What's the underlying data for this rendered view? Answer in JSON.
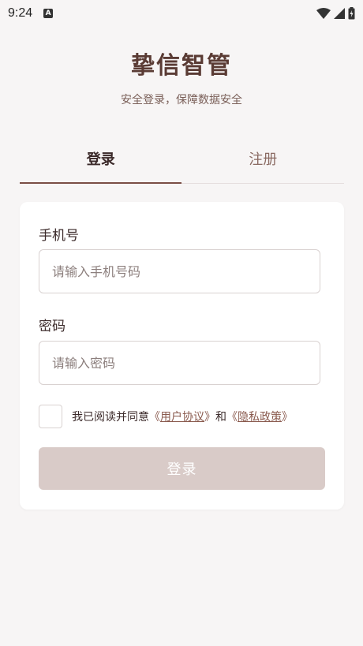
{
  "status_bar": {
    "time": "9:24",
    "notification_letter": "A"
  },
  "header": {
    "title": "挚信智管",
    "subtitle": "安全登录，保障数据安全"
  },
  "tabs": [
    {
      "label": "登录",
      "active": true
    },
    {
      "label": "注册",
      "active": false
    }
  ],
  "form": {
    "phone": {
      "label": "手机号",
      "placeholder": "请输入手机号码",
      "value": ""
    },
    "password": {
      "label": "密码",
      "placeholder": "请输入密码",
      "value": ""
    },
    "agreement": {
      "checked": false,
      "prefix": "我已阅读并同意",
      "open_bracket": "《",
      "close_bracket": "》",
      "user_agreement": "用户协议",
      "conjunction": "和",
      "privacy_policy": "隐私政策"
    },
    "submit_label": "登录"
  },
  "colors": {
    "brand": "#5a3b34",
    "accent": "#7a4e45",
    "button_disabled": "#d9cbc8",
    "background": "#f7f5f5"
  }
}
